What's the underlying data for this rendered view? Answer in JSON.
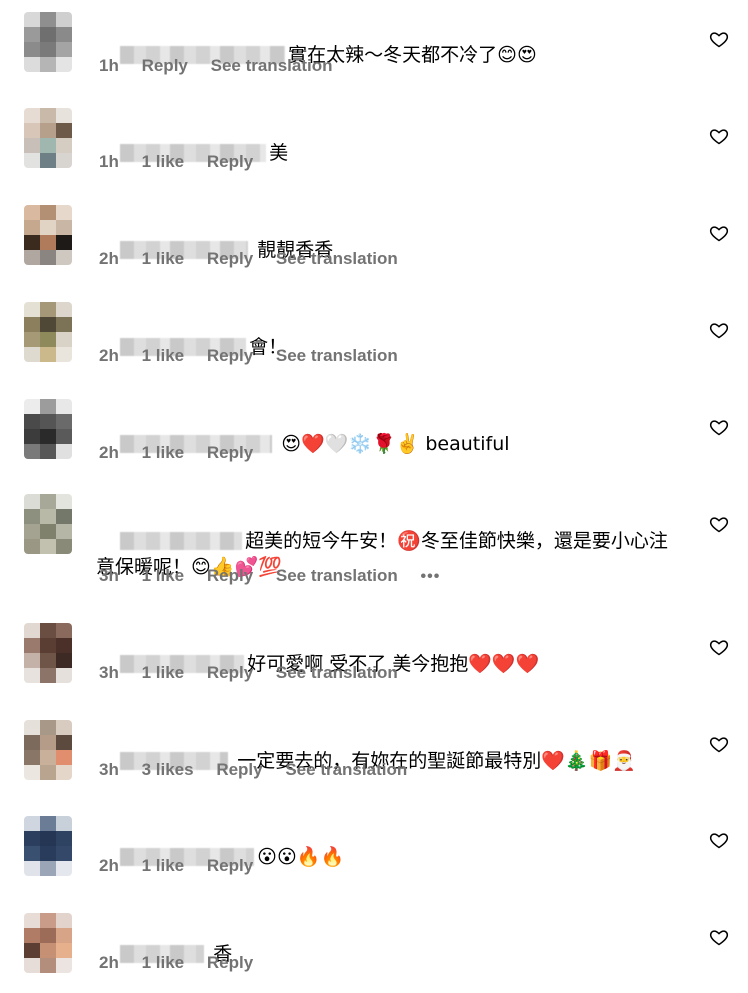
{
  "comments": [
    {
      "text": "實在太辣～冬天都不冷了😊😍",
      "time": "1h",
      "likes": "",
      "reply": "Reply",
      "translate": "See translation"
    },
    {
      "text": "美",
      "time": "1h",
      "likes": "1 like",
      "reply": "Reply",
      "translate": ""
    },
    {
      "text": "靚靚香香",
      "time": "2h",
      "likes": "1 like",
      "reply": "Reply",
      "translate": "See translation"
    },
    {
      "text": "會！",
      "time": "2h",
      "likes": "1 like",
      "reply": "Reply",
      "translate": "See translation"
    },
    {
      "text": "😍❤️🤍❄️🌹✌️ beautiful",
      "time": "2h",
      "likes": "1 like",
      "reply": "Reply",
      "translate": ""
    },
    {
      "text": "超美的短今午安！㊗️冬至佳節快樂，還是要小心注意保暖呢！😊👍💕💯",
      "time": "3h",
      "likes": "1 like",
      "reply": "Reply",
      "translate": "See translation",
      "more": "•••"
    },
    {
      "text": "好可愛啊 受不了 美今抱抱❤️❤️❤️",
      "time": "3h",
      "likes": "1 like",
      "reply": "Reply",
      "translate": "See translation"
    },
    {
      "text": "一定要去的，有妳在的聖誕節最特別❤️🎄🎁🎅",
      "time": "3h",
      "likes": "3 likes",
      "reply": "Reply",
      "translate": "See translation"
    },
    {
      "text": "😮😮🔥🔥",
      "time": "2h",
      "likes": "1 like",
      "reply": "Reply",
      "translate": ""
    },
    {
      "text": "香",
      "time": "2h",
      "likes": "1 like",
      "reply": "Reply",
      "translate": ""
    }
  ],
  "icons": {
    "like": "heart-outline-icon",
    "more": "more-options-icon"
  },
  "colors": {
    "meta": "#737373",
    "text": "#000000",
    "background": "#ffffff"
  }
}
